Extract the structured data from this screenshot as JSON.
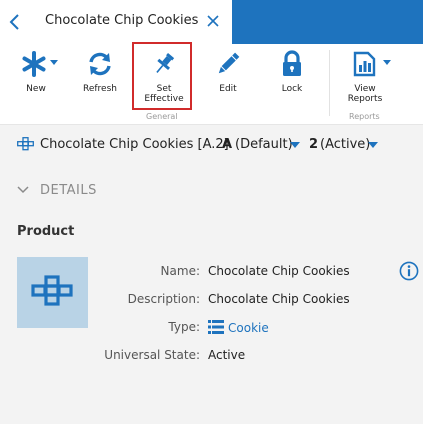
{
  "tab": {
    "title": "Chocolate Chip Cookies"
  },
  "ribbon": {
    "new_label": "New",
    "refresh_label": "Refresh",
    "set_effective_label_line1": "Set",
    "set_effective_label_line2": "Effective",
    "edit_label": "Edit",
    "lock_label": "Lock",
    "view_reports_label_line1": "View",
    "view_reports_label_line2": "Reports",
    "group_general": "General",
    "group_reports": "Reports"
  },
  "item": {
    "name": "Chocolate Chip Cookies [A.2]",
    "revision_letter": "A",
    "revision_label": "(Default)",
    "version_number": "2",
    "version_label": "(Active)"
  },
  "details": {
    "section_title": "DETAILS",
    "product_title": "Product",
    "fields": [
      {
        "label": "Name:",
        "value": "Chocolate Chip Cookies"
      },
      {
        "label": "Description:",
        "value": "Chocolate Chip Cookies"
      },
      {
        "label": "Type:",
        "value": "Cookie"
      },
      {
        "label": "Universal State:",
        "value": "Active"
      }
    ]
  },
  "icons": {
    "back": "chevron-left-icon",
    "close": "close-icon",
    "new": "asterisk-icon",
    "refresh": "refresh-icon",
    "set_effective": "pushpin-icon",
    "edit": "pencil-icon",
    "lock": "lock-icon",
    "view_reports": "report-icon",
    "product_type": "product-blocks-icon",
    "type": "list-icon",
    "info": "info-icon"
  },
  "colors": {
    "accent": "#1e73be",
    "highlight_border": "#d12b2b",
    "thumbnail_bg": "#b9d3e6"
  }
}
